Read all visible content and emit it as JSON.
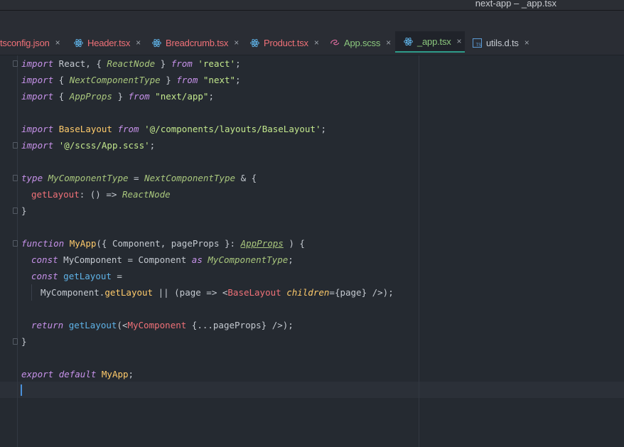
{
  "window": {
    "title": "next-app – _app.tsx"
  },
  "tabs": [
    {
      "label": "tsconfig.json",
      "icon": "json-file-icon",
      "color": "#f07178",
      "active": false
    },
    {
      "label": "Header.tsx",
      "icon": "react-icon",
      "color": "#f07178",
      "active": false
    },
    {
      "label": "Breadcrumb.tsx",
      "icon": "react-icon",
      "color": "#f07178",
      "active": false
    },
    {
      "label": "Product.tsx",
      "icon": "react-icon",
      "color": "#f07178",
      "active": false
    },
    {
      "label": "App.scss",
      "icon": "sass-icon",
      "color": "#8bc77d",
      "active": false
    },
    {
      "label": "_app.tsx",
      "icon": "react-icon",
      "color": "#8bc77d",
      "active": true
    },
    {
      "label": "utils.d.ts",
      "icon": "typescript-icon",
      "color": "#c4c9d0",
      "active": false
    }
  ],
  "tab_close_glyph": "×",
  "code": {
    "l1": {
      "a": "import",
      "b": " React, { ",
      "c": "ReactNode",
      "d": " } ",
      "e": "from",
      "f": " ",
      "g": "'react'",
      "h": ";"
    },
    "l2": {
      "a": "import",
      "b": " { ",
      "c": "NextComponentType",
      "d": " } ",
      "e": "from",
      "f": " ",
      "g": "\"next\"",
      "h": ";"
    },
    "l3": {
      "a": "import",
      "b": " { ",
      "c": "AppProps",
      "d": " } ",
      "e": "from",
      "f": " ",
      "g": "\"next/app\"",
      "h": ";"
    },
    "l5": {
      "a": "import",
      "b": " ",
      "c": "BaseLayout",
      "d": " ",
      "e": "from",
      "f": " ",
      "g": "'@/components/layouts/BaseLayout'",
      "h": ";"
    },
    "l6": {
      "a": "import",
      "b": " ",
      "g": "'@/scss/App.scss'",
      "h": ";"
    },
    "l8": {
      "a": "type",
      "b": " ",
      "c": "MyComponentType",
      "d": " = ",
      "e": "NextComponentType",
      "f": " & {"
    },
    "l9": {
      "a": "getLayout",
      "b": ": () => ",
      "c": "ReactNode"
    },
    "l10": {
      "a": "}"
    },
    "l12": {
      "a": "function",
      "b": " ",
      "c": "MyApp",
      "d": "({ Component, pageProps }: ",
      "e": "AppProps",
      "f": " ) {"
    },
    "l13": {
      "a": "const",
      "b": " MyComponent = Component ",
      "c": "as",
      "d": " ",
      "e": "MyComponentType",
      "f": ";"
    },
    "l14": {
      "a": "const",
      "b": " ",
      "c": "getLayout",
      "d": " ="
    },
    "l15": {
      "a": "MyComponent.",
      "b": "getLayout",
      "c": " || (page => <",
      "d": "BaseLayout",
      "e": " ",
      "f": "children",
      "g": "={page} />);"
    },
    "l17": {
      "a": "return",
      "b": " ",
      "c": "getLayout",
      "d": "(<",
      "e": "MyComponent",
      "f": " {...pageProps} />);"
    },
    "l18": {
      "a": "}"
    },
    "l20": {
      "a": "export",
      "b": " ",
      "c": "default",
      "d": " ",
      "e": "MyApp",
      "f": ";"
    }
  }
}
